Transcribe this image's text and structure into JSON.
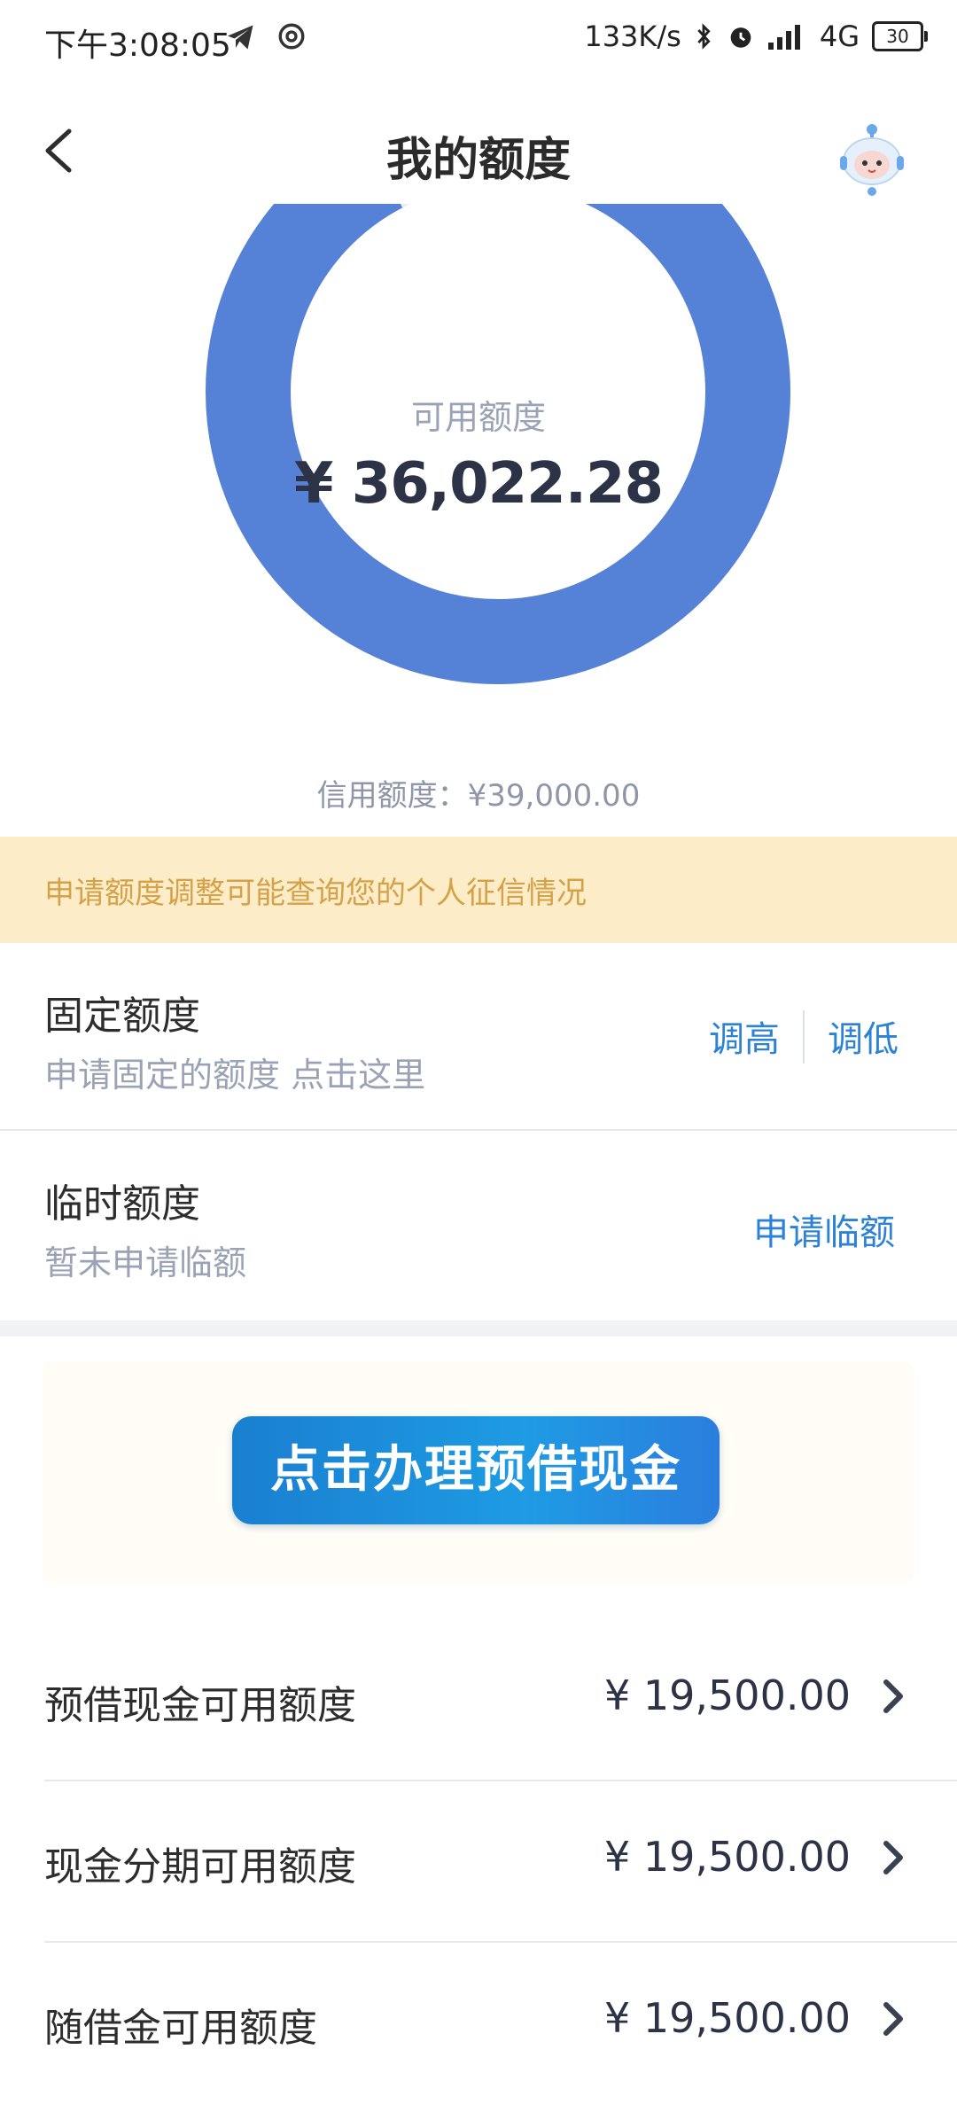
{
  "status_bar": {
    "time": "下午3:08:05",
    "speed": "133K/s",
    "network": "4G",
    "battery": "30"
  },
  "header": {
    "title": "我的额度"
  },
  "donut": {
    "available_label": "可用额度",
    "available_value": "¥ 36,022.28",
    "available_fraction": 0.9237,
    "used_color": "#ebedf0",
    "available_color": "#5582d6",
    "credit_label": "信用额度：¥39,000.00"
  },
  "notice": {
    "text": "申请额度调整可能查询您的个人征信情况"
  },
  "fixed_limit": {
    "title": "固定额度",
    "subtitle": "申请固定的额度 点击这里",
    "raise_label": "调高",
    "lower_label": "调低"
  },
  "temp_limit": {
    "title": "临时额度",
    "subtitle": "暂未申请临额",
    "apply_label": "申请临额"
  },
  "banner": {
    "button_label": "点击办理预借现金"
  },
  "credit_list": [
    {
      "label": "预借现金可用额度",
      "amount": "¥ 19,500.00"
    },
    {
      "label": "现金分期可用额度",
      "amount": "¥ 19,500.00"
    },
    {
      "label": "随借金可用额度",
      "amount": "¥ 19,500.00"
    }
  ],
  "colors": {
    "accent_link": "#2c82d6",
    "notice_bg": "#fcecc7",
    "notice_text": "#d5a24a"
  }
}
